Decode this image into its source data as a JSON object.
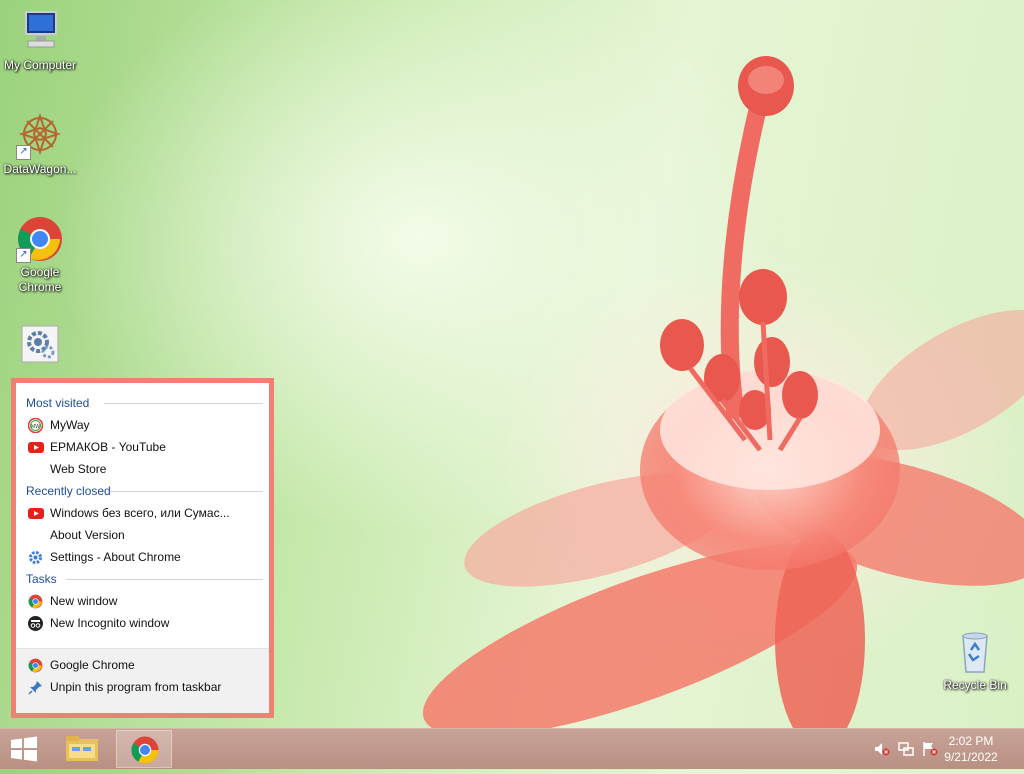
{
  "desktop": {
    "icons": [
      {
        "label": "My Computer"
      },
      {
        "label": "DataWagon..."
      },
      {
        "label": "Google Chrome"
      },
      {
        "label": ""
      },
      {
        "label": "Recycle Bin"
      }
    ]
  },
  "jumplist": {
    "most_visited": {
      "title": "Most visited",
      "items": [
        {
          "label": "MyWay",
          "icon": "myway-icon"
        },
        {
          "label": "ЕРМАКОВ - YouTube",
          "icon": "youtube-icon"
        },
        {
          "label": "Web Store",
          "icon": ""
        }
      ]
    },
    "recently_closed": {
      "title": "Recently closed",
      "items": [
        {
          "label": "Windows без всего, или Сумас...",
          "icon": "youtube-icon"
        },
        {
          "label": "About Version",
          "icon": ""
        },
        {
          "label": "Settings - About Chrome",
          "icon": "gear-icon"
        }
      ]
    },
    "tasks": {
      "title": "Tasks",
      "items": [
        {
          "label": "New window",
          "icon": "chrome-icon"
        },
        {
          "label": "New Incognito window",
          "icon": "incognito-icon"
        }
      ]
    },
    "footer": {
      "items": [
        {
          "label": "Google Chrome",
          "icon": "chrome-icon"
        },
        {
          "label": "Unpin this program from taskbar",
          "icon": "unpin-icon"
        }
      ]
    },
    "border_color": "#f08074"
  },
  "taskbar": {
    "clock": {
      "time": "2:02 PM",
      "date": "9/21/2022"
    },
    "color": "#c8a397"
  }
}
